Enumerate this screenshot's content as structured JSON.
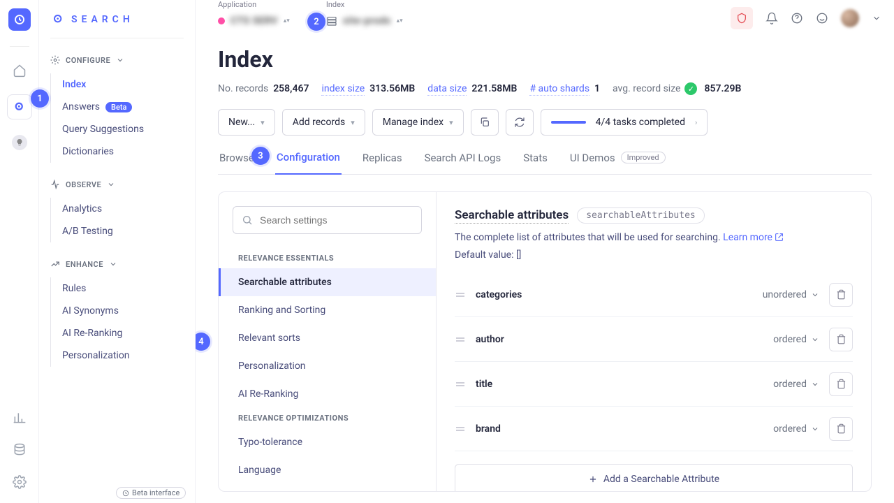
{
  "brand": "SEARCH",
  "annotations": [
    "1",
    "2",
    "3",
    "4"
  ],
  "topbar": {
    "application_label": "Application",
    "application_value": "CTS SERV",
    "index_label": "Index",
    "index_value": "site-prodx"
  },
  "sidebar": {
    "sections": {
      "configure": {
        "title": "CONFIGURE",
        "items": [
          "Index",
          "Answers",
          "Query Suggestions",
          "Dictionaries"
        ],
        "beta_label": "Beta"
      },
      "observe": {
        "title": "OBSERVE",
        "items": [
          "Analytics",
          "A/B Testing"
        ]
      },
      "enhance": {
        "title": "ENHANCE",
        "items": [
          "Rules",
          "AI Synonyms",
          "AI Re-Ranking",
          "Personalization"
        ]
      }
    },
    "beta_interface": "Beta interface"
  },
  "page": {
    "title": "Index",
    "stats": {
      "records_label": "No. records",
      "records_value": "258,467",
      "index_size_label": "index size",
      "index_size_value": "313.56MB",
      "data_size_label": "data size",
      "data_size_value": "221.58MB",
      "shards_label": "# auto shards",
      "shards_value": "1",
      "avg_label": "avg. record size",
      "avg_value": "857.29B"
    },
    "toolbar": {
      "new": "New...",
      "add": "Add records",
      "manage": "Manage index",
      "tasks": "4/4 tasks completed"
    },
    "tabs": [
      "Browse",
      "Configuration",
      "Replicas",
      "Search API Logs",
      "Stats",
      "UI Demos"
    ],
    "improved": "Improved"
  },
  "config": {
    "search_placeholder": "Search settings",
    "groups": {
      "essentials": {
        "title": "RELEVANCE ESSENTIALS",
        "items": [
          "Searchable attributes",
          "Ranking and Sorting",
          "Relevant sorts",
          "Personalization",
          "AI Re-Ranking"
        ]
      },
      "optimizations": {
        "title": "RELEVANCE OPTIMIZATIONS",
        "items": [
          "Typo-tolerance",
          "Language"
        ]
      }
    }
  },
  "detail": {
    "title": "Searchable attributes",
    "code": "searchableAttributes",
    "desc": "The complete list of attributes that will be used for searching.",
    "learn_more": "Learn more",
    "default_label": "Default value: []",
    "attributes": [
      {
        "name": "categories",
        "order": "unordered"
      },
      {
        "name": "author",
        "order": "ordered"
      },
      {
        "name": "title",
        "order": "ordered"
      },
      {
        "name": "brand",
        "order": "ordered"
      }
    ],
    "add_label": "Add a Searchable Attribute"
  }
}
